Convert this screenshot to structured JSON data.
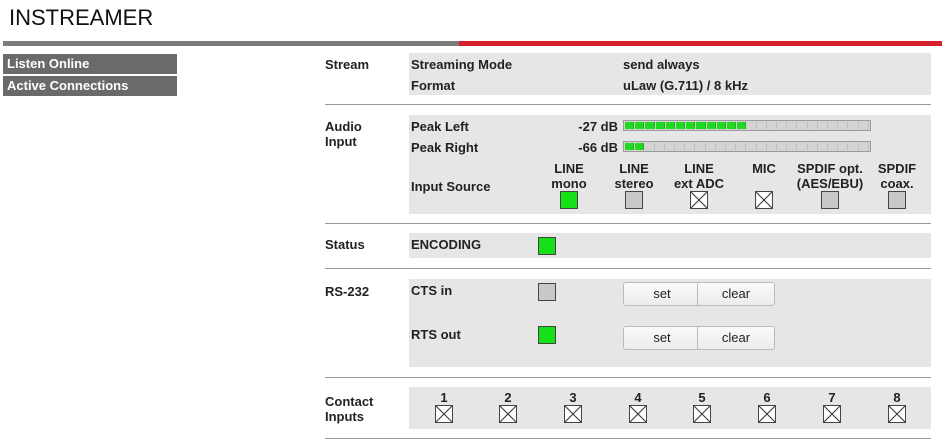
{
  "app_title": "INSTREAMER",
  "nav": [
    "Listen Online",
    "Active Connections"
  ],
  "stream": {
    "label": "Stream",
    "mode_label": "Streaming Mode",
    "mode_value": "send always",
    "format_label": "Format",
    "format_value": "uLaw (G.711) / 8 kHz"
  },
  "audio": {
    "label_line1": "Audio",
    "label_line2": "Input",
    "peak_left_label": "Peak Left",
    "peak_left_value": "-27 dB",
    "peak_left_level": 0.5,
    "peak_right_label": "Peak Right",
    "peak_right_value": "-66 dB",
    "peak_right_level": 0.083,
    "input_source_label": "Input Source",
    "sources": [
      {
        "l1": "LINE",
        "l2": "mono",
        "state": "active"
      },
      {
        "l1": "LINE",
        "l2": "stereo",
        "state": "available"
      },
      {
        "l1": "LINE",
        "l2": "ext ADC",
        "state": "unavailable"
      },
      {
        "l1": "MIC",
        "l2": "",
        "state": "unavailable"
      },
      {
        "l1": "SPDIF opt.",
        "l2": "(AES/EBU)",
        "state": "available"
      },
      {
        "l1": "SPDIF",
        "l2": "coax.",
        "state": "available"
      }
    ]
  },
  "status": {
    "label": "Status",
    "value": "ENCODING",
    "state": "on"
  },
  "rs232": {
    "label": "RS-232",
    "cts_label": "CTS in",
    "cts_state": "off",
    "rts_label": "RTS out",
    "rts_state": "on",
    "set_label": "set",
    "clear_label": "clear"
  },
  "contacts": {
    "label_line1": "Contact",
    "label_line2": "Inputs",
    "numbers": [
      "1",
      "2",
      "3",
      "4",
      "5",
      "6",
      "7",
      "8"
    ]
  },
  "colors": {
    "accent_red": "#d4202a",
    "nav_bg": "#6a6a6a",
    "led_green": "#16e016",
    "meter_green": "#22d922"
  }
}
